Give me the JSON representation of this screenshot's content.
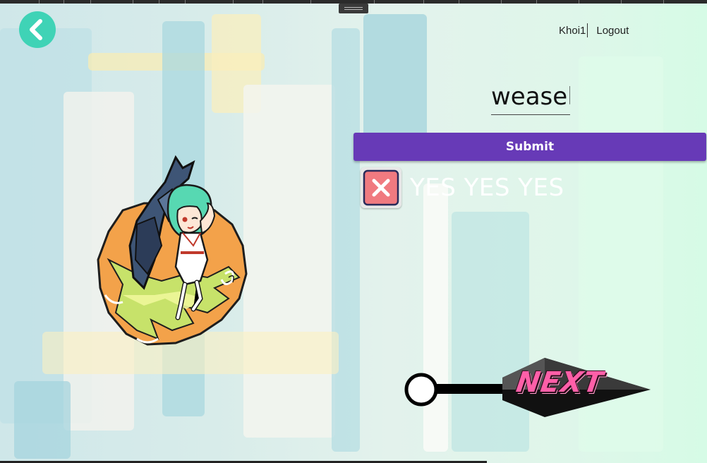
{
  "header": {
    "username": "Khoi1",
    "logout_label": "Logout"
  },
  "answer_input": {
    "value": "weasel"
  },
  "submit_label": "Submit",
  "result": {
    "text": "YES YES YES",
    "status_icon": "close-icon"
  },
  "next_button": {
    "label": "NEXT",
    "icon": "kunai-icon"
  },
  "character_image": {
    "icon": "chibi-character-with-beetle-illustration"
  },
  "colors": {
    "back_button": "#3fd3b6",
    "submit_button": "#673ab7",
    "result_icon_fill": "#f07a80",
    "next_text": "#ff5fa8"
  }
}
